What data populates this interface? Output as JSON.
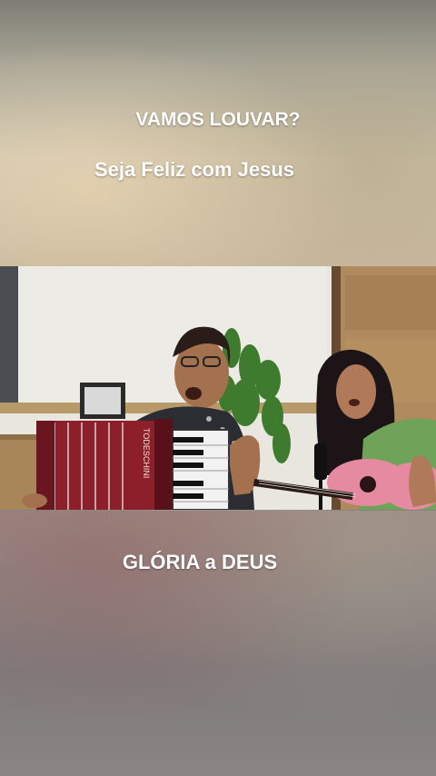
{
  "captions": {
    "top_line_1": "VAMOS LOUVAR?",
    "top_line_2": "Seja Feliz com Jesus",
    "bottom_line": "GLÓRIA a DEUS"
  },
  "video": {
    "accordion_brand": "TODESCHINI"
  },
  "colors": {
    "caption_text": "#ffffff",
    "accordion_red": "#8c1f2a",
    "guitar_pink": "#e58aa0",
    "shirt_green": "#6fa35a"
  }
}
